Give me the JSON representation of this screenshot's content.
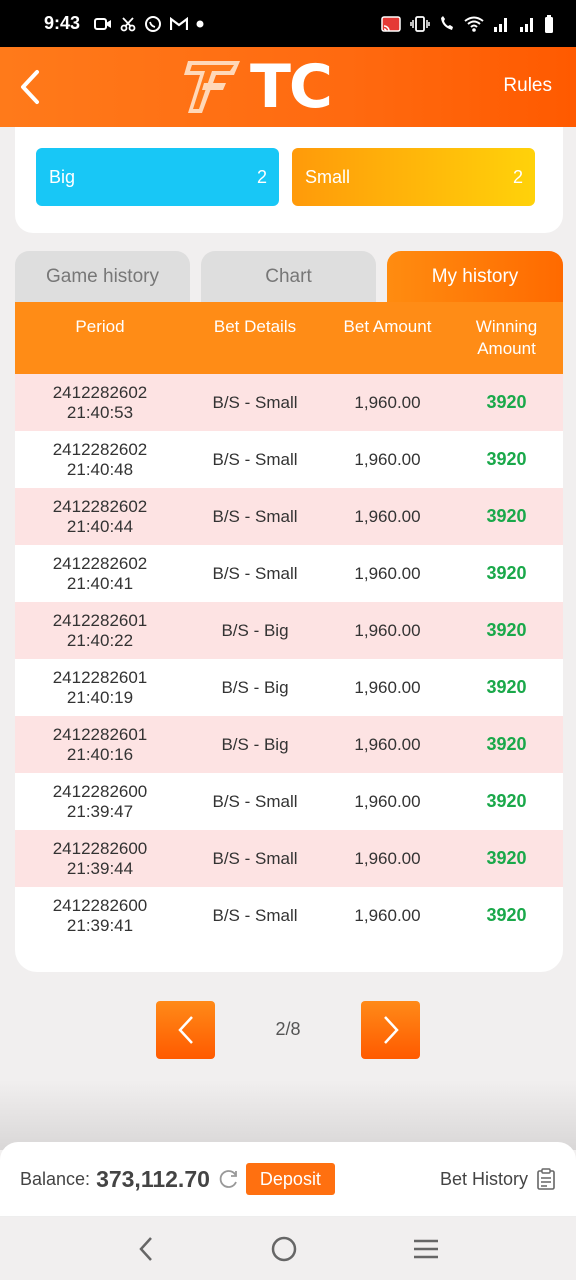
{
  "status_bar": {
    "time": "9:43"
  },
  "header": {
    "logo_text": "TC",
    "rules_label": "Rules"
  },
  "bet_options": [
    {
      "label": "Big",
      "count": "2"
    },
    {
      "label": "Small",
      "count": "2"
    }
  ],
  "tabs": [
    {
      "label": "Game history"
    },
    {
      "label": "Chart"
    },
    {
      "label": "My history"
    }
  ],
  "table": {
    "headers": [
      "Period",
      "Bet Details",
      "Bet Amount",
      "Winning Amount"
    ],
    "rows": [
      {
        "period": "2412282602",
        "time": "21:40:53",
        "details": "B/S - Small",
        "amount": "1,960.00",
        "winning": "3920"
      },
      {
        "period": "2412282602",
        "time": "21:40:48",
        "details": "B/S - Small",
        "amount": "1,960.00",
        "winning": "3920"
      },
      {
        "period": "2412282602",
        "time": "21:40:44",
        "details": "B/S - Small",
        "amount": "1,960.00",
        "winning": "3920"
      },
      {
        "period": "2412282602",
        "time": "21:40:41",
        "details": "B/S - Small",
        "amount": "1,960.00",
        "winning": "3920"
      },
      {
        "period": "2412282601",
        "time": "21:40:22",
        "details": "B/S - Big",
        "amount": "1,960.00",
        "winning": "3920"
      },
      {
        "period": "2412282601",
        "time": "21:40:19",
        "details": "B/S - Big",
        "amount": "1,960.00",
        "winning": "3920"
      },
      {
        "period": "2412282601",
        "time": "21:40:16",
        "details": "B/S - Big",
        "amount": "1,960.00",
        "winning": "3920"
      },
      {
        "period": "2412282600",
        "time": "21:39:47",
        "details": "B/S - Small",
        "amount": "1,960.00",
        "winning": "3920"
      },
      {
        "period": "2412282600",
        "time": "21:39:44",
        "details": "B/S - Small",
        "amount": "1,960.00",
        "winning": "3920"
      },
      {
        "period": "2412282600",
        "time": "21:39:41",
        "details": "B/S - Small",
        "amount": "1,960.00",
        "winning": "3920"
      }
    ]
  },
  "pagination": {
    "label": "2/8"
  },
  "balance": {
    "label": "Balance:",
    "value": "373,112.70",
    "deposit_label": "Deposit",
    "bet_history_label": "Bet History"
  },
  "colors": {
    "accent": "#ff6a10",
    "big": "#18c7f6",
    "small": "#ffb00a",
    "win": "#1aa84a",
    "row_highlight": "#fde3e3"
  }
}
